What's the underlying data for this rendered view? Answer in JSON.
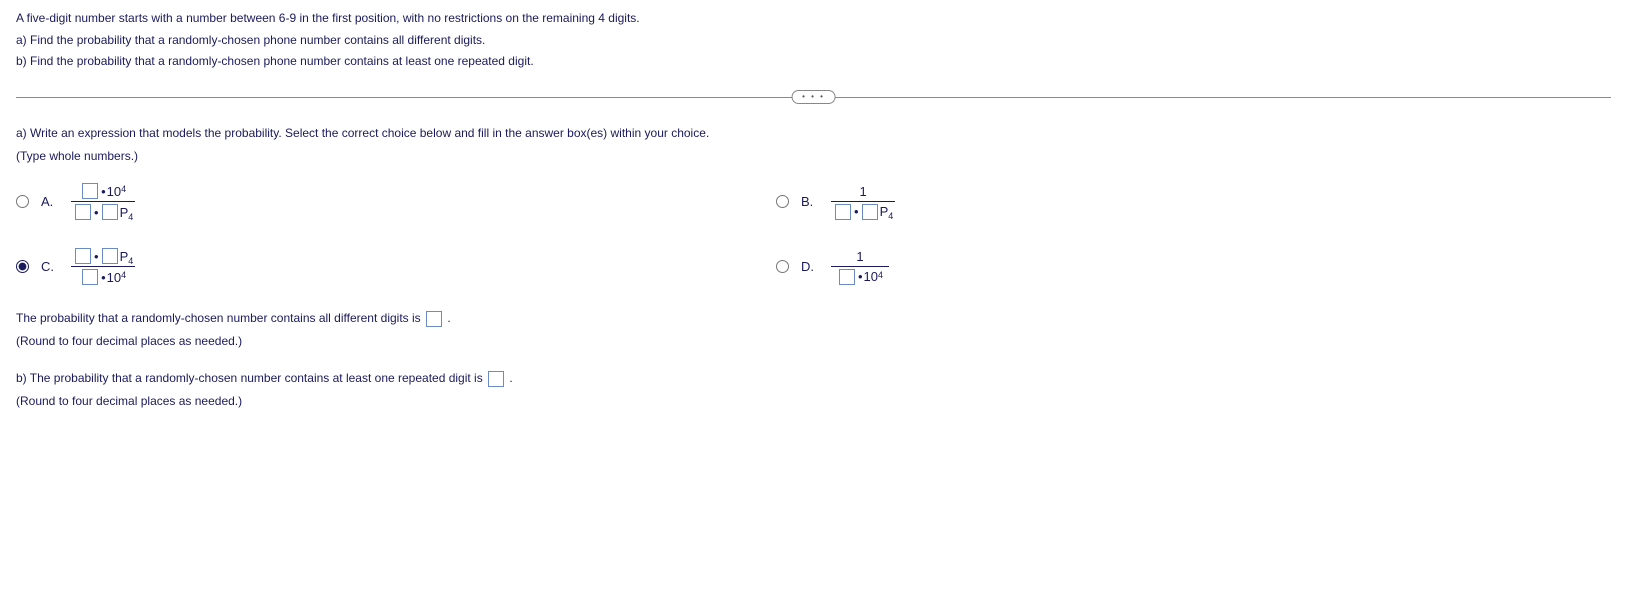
{
  "header": {
    "intro": "A five-digit number starts with a number between 6-9 in the first position, with no restrictions on the remaining 4 digits.",
    "part_a": "a) Find the probability that a randomly-chosen phone number contains all different digits.",
    "part_b": "b) Find the probability that a randomly-chosen phone number contains at least one repeated digit."
  },
  "divider_glyph": "• • •",
  "instruction": {
    "line1": "a) Write an expression that models the probability. Select the correct choice below and fill in the answer box(es) within your choice.",
    "line2": "(Type whole numbers.)"
  },
  "choices": {
    "A": {
      "label": "A.",
      "num_suffix_base": "10",
      "num_suffix_exp": "4",
      "den_P": "P",
      "den_P_sub": "4"
    },
    "B": {
      "label": "B.",
      "num": "1",
      "den_P": "P",
      "den_P_sub": "4"
    },
    "C": {
      "label": "C.",
      "num_P": "P",
      "num_P_sub": "4",
      "den_suffix_base": "10",
      "den_suffix_exp": "4"
    },
    "D": {
      "label": "D.",
      "num": "1",
      "den_suffix_base": "10",
      "den_suffix_exp": "4"
    }
  },
  "followup1": {
    "text_before": "The probability that a randomly-chosen number contains all different digits is ",
    "text_after": ".",
    "hint": "(Round to four decimal places as needed.)"
  },
  "followup2": {
    "text_before": "b) The probability that a randomly-chosen number contains at least one repeated digit is ",
    "text_after": ".",
    "hint": "(Round to four decimal places as needed.)"
  }
}
